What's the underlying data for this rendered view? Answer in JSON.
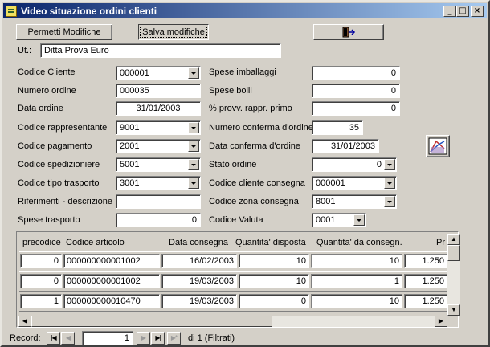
{
  "window": {
    "title": "Video situazione ordini clienti",
    "minimize": "_",
    "maximize": "□",
    "close": "×"
  },
  "toolbar": {
    "permetti": "Permetti Modifiche",
    "salva": "Salva modifiche"
  },
  "ut": {
    "label": "Ut.:",
    "value": "Ditta Prova Euro"
  },
  "left": [
    {
      "label": "Codice Cliente",
      "value": "000001",
      "dropdown": true
    },
    {
      "label": "Numero ordine",
      "value": "000035"
    },
    {
      "label": "Data ordine",
      "value": "31/01/2003"
    },
    {
      "label": "Codice rappresentante",
      "value": "9001",
      "dropdown": true
    },
    {
      "label": "Codice pagamento",
      "value": "2001",
      "dropdown": true
    },
    {
      "label": "Codice spedizioniere",
      "value": "5001",
      "dropdown": true
    },
    {
      "label": "Codice tipo trasporto",
      "value": "3001",
      "dropdown": true
    },
    {
      "label": "Riferimenti - descrizione",
      "value": ""
    },
    {
      "label": "Spese trasporto",
      "value": "0"
    }
  ],
  "right": [
    {
      "label": "Spese imballaggi",
      "value": "0"
    },
    {
      "label": "Spese bolli",
      "value": "0"
    },
    {
      "label": "% provv. rappr. primo",
      "value": "0"
    },
    {
      "label": "Numero conferma d'ordine",
      "value": "35"
    },
    {
      "label": "Data conferma d'ordine",
      "value": "31/01/2003"
    },
    {
      "label": "Stato ordine",
      "value": "0"
    },
    {
      "label": "Codice cliente consegna",
      "value": "000001"
    },
    {
      "label": "Codice zona consegna",
      "value": "8001"
    },
    {
      "label": "Codice Valuta",
      "value": "0001"
    }
  ],
  "grid": {
    "headers": [
      "precodice",
      "Codice articolo",
      "Data consegna",
      "Quantita' disposta",
      "Quantita' da consegn.",
      "Pr"
    ],
    "rows": [
      [
        "0",
        "000000000001002",
        "16/02/2003",
        "10",
        "10",
        "1.250"
      ],
      [
        "0",
        "000000000001002",
        "19/03/2003",
        "10",
        "1",
        "1.250"
      ],
      [
        "1",
        "000000000010470",
        "19/03/2003",
        "0",
        "10",
        "1.250"
      ]
    ]
  },
  "record": {
    "label": "Record:",
    "current": "1",
    "total": "di 1 (Filtrati)"
  }
}
